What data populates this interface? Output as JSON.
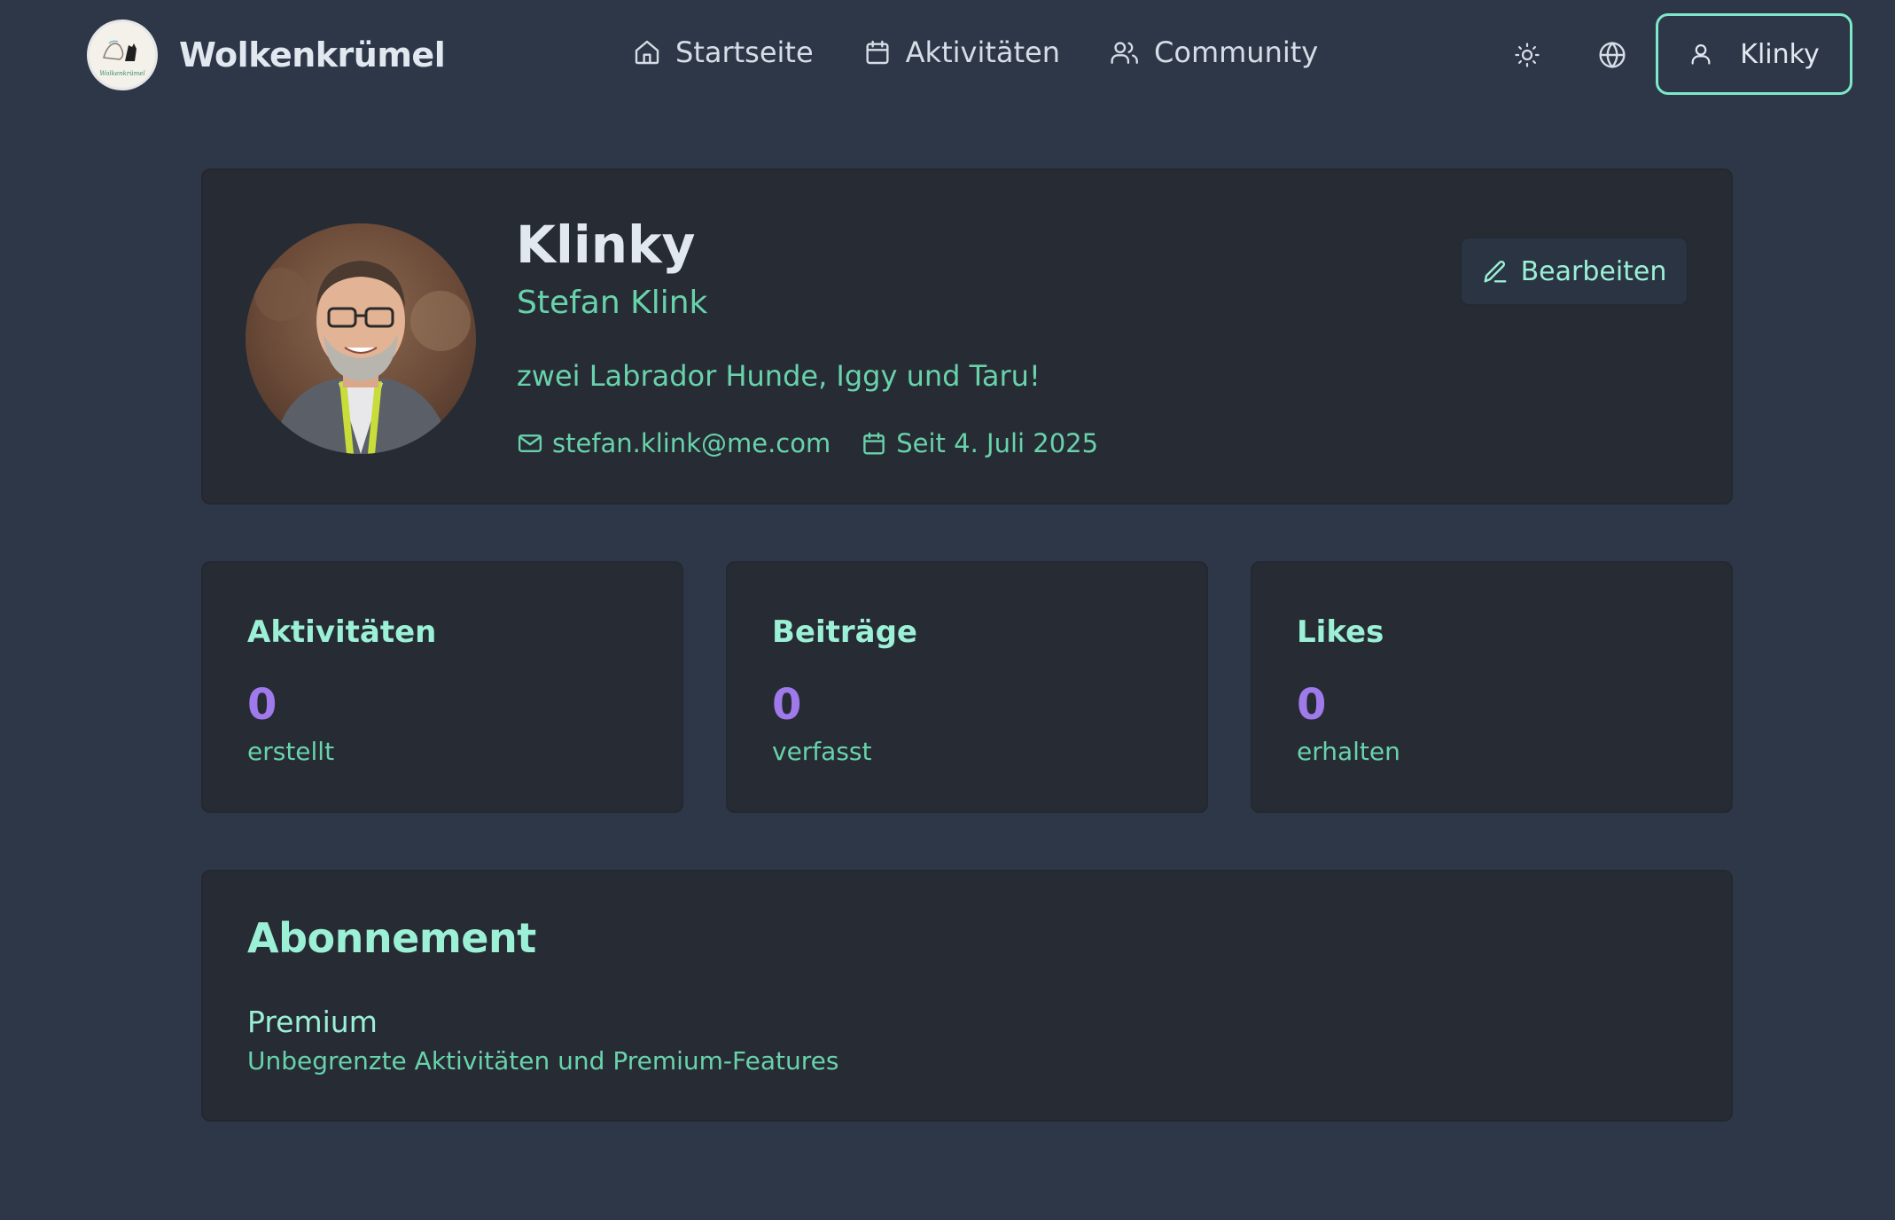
{
  "header": {
    "brand": "Wolkenkrümel",
    "logo_text": "Wolkenkrümel",
    "nav": [
      {
        "label": "Startseite",
        "icon": "home-icon"
      },
      {
        "label": "Aktivitäten",
        "icon": "calendar-icon"
      },
      {
        "label": "Community",
        "icon": "users-icon"
      }
    ],
    "theme_icon": "sun-icon",
    "language_icon": "globe-icon",
    "user_label": "Klinky"
  },
  "profile": {
    "username": "Klinky",
    "full_name": "Stefan Klink",
    "bio": "zwei Labrador Hunde, Iggy und Taru!",
    "email": "stefan.klink@me.com",
    "member_since": "Seit 4. Juli 2025",
    "edit_label": "Bearbeiten"
  },
  "stats": [
    {
      "title": "Aktivitäten",
      "value": "0",
      "label": "erstellt"
    },
    {
      "title": "Beiträge",
      "value": "0",
      "label": "verfasst"
    },
    {
      "title": "Likes",
      "value": "0",
      "label": "erhalten"
    }
  ],
  "subscription": {
    "title": "Abonnement",
    "plan": "Premium",
    "description": "Unbegrenzte Aktivitäten und Premium-Features"
  },
  "colors": {
    "background": "#2d3748",
    "card": "#272b34",
    "accent": "#68d3ab",
    "accent_light": "#9bf0d6",
    "stat_value": "#9f7aea"
  }
}
